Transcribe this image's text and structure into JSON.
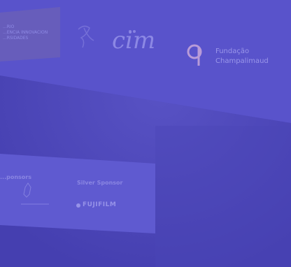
{
  "photo": {
    "subject": "presentation-slide-sponsor-logos",
    "tint_color": "#4a44b8",
    "slide_color": "#5a55cc"
  },
  "logo_banner": {
    "partner_left_text": [
      "...RIO",
      "...ENCIA INNOVACION",
      "...RSIDADES"
    ],
    "cim_mark": "cim",
    "champalimaud_mark": "cf",
    "champalimaud_name": [
      "Fundação",
      "Champalimaud"
    ]
  },
  "sponsors_panel": {
    "heading_left": "...ponsors",
    "heading_right": "Silver Sponsor",
    "silver_sponsor_logo": "FUJIFILM"
  }
}
